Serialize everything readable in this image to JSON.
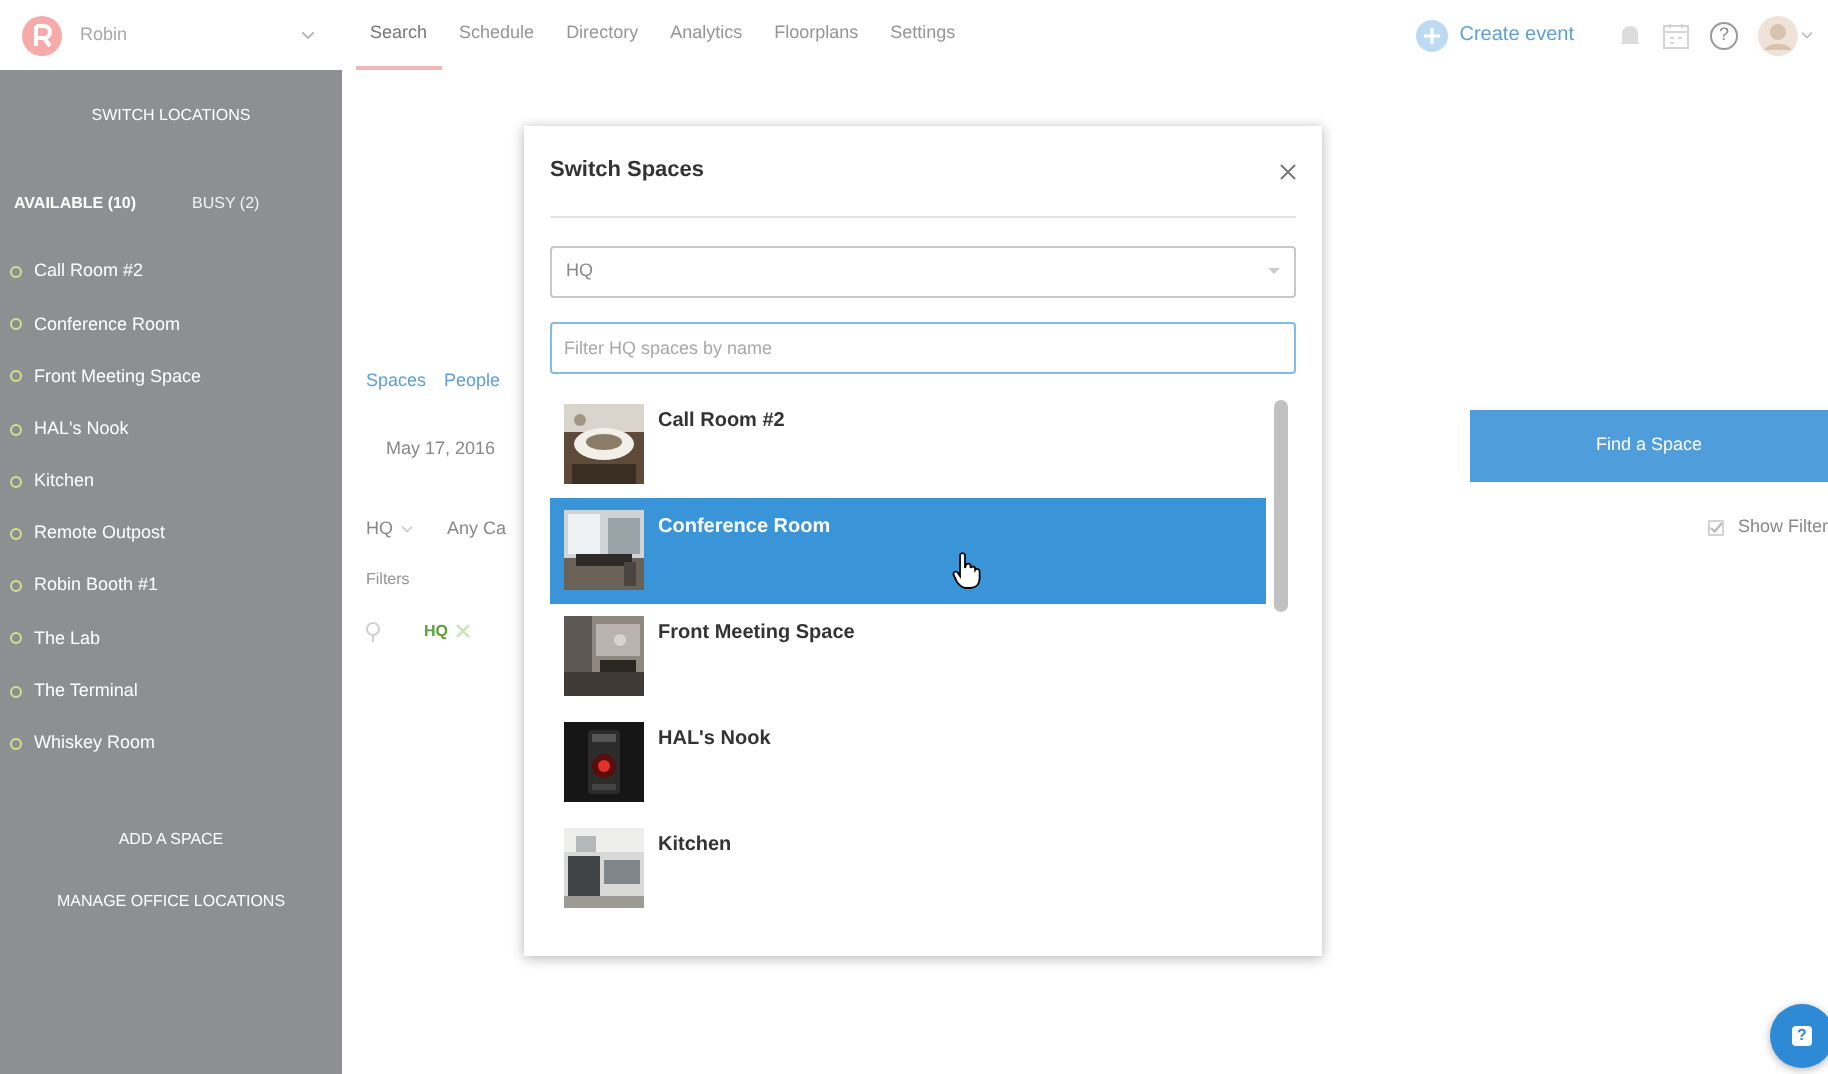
{
  "header": {
    "brand": "Robin",
    "nav": [
      {
        "label": "Search",
        "selected": true
      },
      {
        "label": "Schedule",
        "selected": false
      },
      {
        "label": "Directory",
        "selected": false
      },
      {
        "label": "Analytics",
        "selected": false
      },
      {
        "label": "Floorplans",
        "selected": false
      },
      {
        "label": "Settings",
        "selected": false
      }
    ],
    "create_event": "Create event",
    "help": "?"
  },
  "sidebar": {
    "switch_locations": "SWITCH LOCATIONS",
    "tabs": [
      {
        "label": "AVAILABLE (10)",
        "selected": true
      },
      {
        "label": "BUSY (2)",
        "selected": false
      }
    ],
    "spaces": [
      "Call Room #2",
      "Conference Room",
      "Front Meeting Space",
      "HAL's Nook",
      "Kitchen",
      "Remote Outpost",
      "Robin Booth #1",
      "The Lab",
      "The Terminal",
      "Whiskey Room"
    ],
    "actions": [
      "ADD A SPACE",
      "MANAGE OFFICE LOCATIONS"
    ]
  },
  "search_panel": {
    "tabs": [
      "Spaces",
      "People"
    ],
    "date": "May 17, 2016",
    "location": "HQ",
    "category": "Any Ca",
    "filters_label": "Filters",
    "filter_tags": [
      "HQ"
    ],
    "find_button": "Find a Space",
    "show_filters": {
      "label": "Show Filter",
      "checked": true
    }
  },
  "modal": {
    "title": "Switch Spaces",
    "location_select": "HQ",
    "filter": {
      "placeholder": "Filter HQ spaces by name"
    },
    "spaces": [
      {
        "name": "Call Room #2",
        "selected": false
      },
      {
        "name": "Conference Room",
        "selected": true
      },
      {
        "name": "Front Meeting Space",
        "selected": false
      },
      {
        "name": "HAL's Nook",
        "selected": false
      },
      {
        "name": "Kitchen",
        "selected": false
      }
    ]
  },
  "help_button": "?"
}
